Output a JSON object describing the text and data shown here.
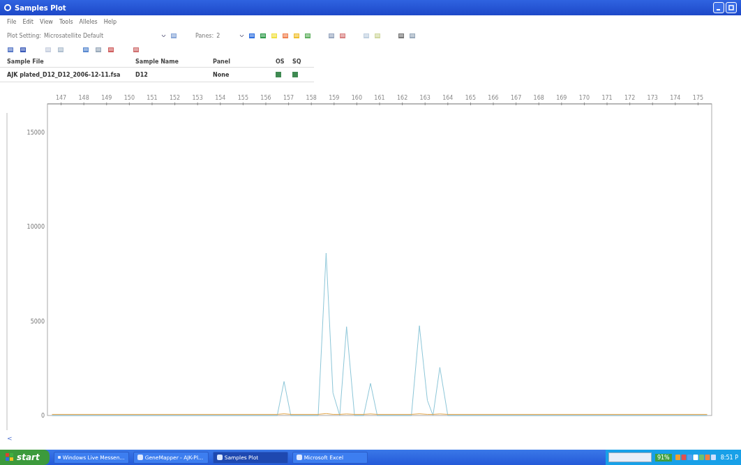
{
  "window": {
    "title": "Samples Plot"
  },
  "menu": [
    "File",
    "Edit",
    "View",
    "Tools",
    "Alleles",
    "Help"
  ],
  "toolbar": {
    "plot_setting": {
      "label": "Plot Setting:",
      "value": "Microsatellite Default"
    },
    "panes": {
      "label": "Panes:",
      "value": "2"
    }
  },
  "table": {
    "columns": [
      "Sample File",
      "Sample Name",
      "Panel",
      "OS",
      "SQ"
    ],
    "rows": [
      {
        "sample_file": "AJK plated_D12_D12_2006-12-11.fsa",
        "sample_name": "D12",
        "panel": "None",
        "os_ok": true,
        "sq_ok": true
      }
    ]
  },
  "plot": {
    "chart_data": {
      "type": "line",
      "xlim": [
        146.4,
        175.6
      ],
      "ylim": [
        0,
        16500
      ],
      "xticks": [
        147,
        148,
        149,
        150,
        151,
        152,
        153,
        154,
        155,
        156,
        157,
        158,
        159,
        160,
        161,
        162,
        163,
        164,
        165,
        166,
        167,
        168,
        169,
        170,
        171,
        172,
        173,
        174,
        175
      ],
      "yticks": [
        0,
        5000,
        10000,
        15000
      ],
      "x": [
        146.6,
        156.5,
        156.8,
        157.1,
        158.3,
        158.65,
        158.95,
        159.25,
        159.55,
        159.9,
        160.3,
        160.6,
        160.9,
        162.4,
        162.75,
        163.1,
        163.35,
        163.65,
        164.0,
        175.4
      ],
      "series": [
        {
          "color": "#8cc6d8",
          "values": [
            0,
            0,
            1800,
            0,
            0,
            8600,
            1200,
            0,
            4700,
            0,
            0,
            1700,
            0,
            0,
            4750,
            800,
            0,
            2550,
            0,
            0
          ]
        },
        {
          "color": "#e0a040",
          "values": [
            60,
            60,
            90,
            60,
            60,
            100,
            60,
            60,
            80,
            60,
            60,
            80,
            60,
            60,
            90,
            60,
            60,
            80,
            60,
            60
          ]
        }
      ]
    }
  },
  "scroll": {
    "left_arrow": "<"
  },
  "taskbar": {
    "start": "start",
    "tasks": [
      {
        "label": "Windows Live Messen...",
        "selected": false
      },
      {
        "label": "GeneMapper - AJK-Pl...",
        "selected": false
      },
      {
        "label": "Samples Plot",
        "selected": true
      },
      {
        "label": "Microsoft Excel",
        "selected": false
      }
    ],
    "battery": "91%",
    "clock": "8:51 P"
  }
}
